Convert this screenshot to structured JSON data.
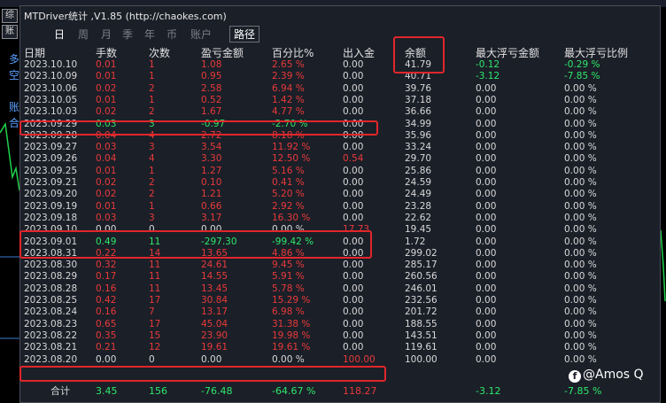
{
  "window": {
    "title": "MTDriver统计 ,V1.85 (http://chaokes.com)"
  },
  "left_tabs": [
    "综",
    "账"
  ],
  "left_glyphs": [
    "多",
    "空",
    "账",
    "合"
  ],
  "tabs": [
    {
      "label": "日",
      "active": true
    },
    {
      "label": "周",
      "active": false
    },
    {
      "label": "月",
      "active": false
    },
    {
      "label": "季",
      "active": false
    },
    {
      "label": "年",
      "active": false
    },
    {
      "label": "币",
      "active": false
    },
    {
      "label": "账户",
      "active": false
    },
    {
      "label": "路径",
      "active": false,
      "boxed": true
    }
  ],
  "columns": [
    "日期",
    "手数",
    "次数",
    "盈亏金额",
    "百分比%",
    "出入金",
    "余额",
    "最大浮亏金额",
    "最大浮亏比例"
  ],
  "rows": [
    {
      "date": "2023.10.10",
      "lots": "0.01",
      "count": "1",
      "pnl": "1.08",
      "pct": "2.65 %",
      "io": "0.00",
      "bal": "41.79",
      "mfe": "-0.12",
      "mfer": "-0.29 %",
      "tone": "red",
      "mfe_tone": "green"
    },
    {
      "date": "2023.10.09",
      "lots": "0.01",
      "count": "1",
      "pnl": "0.95",
      "pct": "2.39 %",
      "io": "0.00",
      "bal": "40.71",
      "mfe": "-3.12",
      "mfer": "-7.85 %",
      "tone": "red",
      "mfe_tone": "green"
    },
    {
      "date": "2023.10.06",
      "lots": "0.02",
      "count": "2",
      "pnl": "2.58",
      "pct": "6.94 %",
      "io": "0.00",
      "bal": "39.76",
      "mfe": "0.00",
      "mfer": "0.00 %",
      "tone": "red",
      "mfe_tone": "white"
    },
    {
      "date": "2023.10.05",
      "lots": "0.01",
      "count": "1",
      "pnl": "0.52",
      "pct": "1.42 %",
      "io": "0.00",
      "bal": "37.18",
      "mfe": "0.00",
      "mfer": "0.00 %",
      "tone": "red",
      "mfe_tone": "white"
    },
    {
      "date": "2023.10.03",
      "lots": "0.02",
      "count": "2",
      "pnl": "1.67",
      "pct": "4.77 %",
      "io": "0.00",
      "bal": "36.66",
      "mfe": "0.00",
      "mfer": "0.00 %",
      "tone": "red",
      "mfe_tone": "white"
    },
    {
      "date": "2023.09.29",
      "lots": "0.03",
      "count": "3",
      "pnl": "-0.97",
      "pct": "-2.70 %",
      "io": "0.00",
      "bal": "34.99",
      "mfe": "0.00",
      "mfer": "0.00 %",
      "tone": "green",
      "mfe_tone": "white"
    },
    {
      "date": "2023.09.28",
      "lots": "0.04",
      "count": "4",
      "pnl": "2.72",
      "pct": "8.18 %",
      "io": "0.00",
      "bal": "35.96",
      "mfe": "0.00",
      "mfer": "0.00 %",
      "tone": "red",
      "mfe_tone": "white"
    },
    {
      "date": "2023.09.27",
      "lots": "0.03",
      "count": "3",
      "pnl": "3.54",
      "pct": "11.92 %",
      "io": "0.00",
      "bal": "33.24",
      "mfe": "0.00",
      "mfer": "0.00 %",
      "tone": "red",
      "mfe_tone": "white"
    },
    {
      "date": "2023.09.26",
      "lots": "0.04",
      "count": "4",
      "pnl": "3.30",
      "pct": "12.50 %",
      "io": "0.54",
      "bal": "29.70",
      "mfe": "0.00",
      "mfer": "0.00 %",
      "tone": "red",
      "mfe_tone": "white",
      "io_tone": "red"
    },
    {
      "date": "2023.09.25",
      "lots": "0.01",
      "count": "1",
      "pnl": "1.27",
      "pct": "5.16 %",
      "io": "0.00",
      "bal": "25.86",
      "mfe": "0.00",
      "mfer": "0.00 %",
      "tone": "red",
      "mfe_tone": "white"
    },
    {
      "date": "2023.09.21",
      "lots": "0.02",
      "count": "2",
      "pnl": "0.10",
      "pct": "0.41 %",
      "io": "0.00",
      "bal": "24.59",
      "mfe": "0.00",
      "mfer": "0.00 %",
      "tone": "red",
      "mfe_tone": "white"
    },
    {
      "date": "2023.09.20",
      "lots": "0.02",
      "count": "2",
      "pnl": "1.21",
      "pct": "5.20 %",
      "io": "0.00",
      "bal": "24.49",
      "mfe": "0.00",
      "mfer": "0.00 %",
      "tone": "red",
      "mfe_tone": "white"
    },
    {
      "date": "2023.09.19",
      "lots": "0.01",
      "count": "1",
      "pnl": "0.66",
      "pct": "2.92 %",
      "io": "0.00",
      "bal": "23.28",
      "mfe": "0.00",
      "mfer": "0.00 %",
      "tone": "red",
      "mfe_tone": "white"
    },
    {
      "date": "2023.09.18",
      "lots": "0.03",
      "count": "3",
      "pnl": "3.17",
      "pct": "16.30 %",
      "io": "0.00",
      "bal": "22.62",
      "mfe": "0.00",
      "mfer": "0.00 %",
      "tone": "red",
      "mfe_tone": "white"
    },
    {
      "date": "2023.09.10",
      "lots": "0.00",
      "count": "0",
      "pnl": "0.00",
      "pct": "0.00 %",
      "io": "17.73",
      "bal": "19.45",
      "mfe": "0.00",
      "mfer": "0.00 %",
      "tone": "white",
      "mfe_tone": "white",
      "io_tone": "red"
    },
    {
      "date": "2023.09.01",
      "lots": "0.49",
      "count": "11",
      "pnl": "-297.30",
      "pct": "-99.42 %",
      "io": "0.00",
      "bal": "1.72",
      "mfe": "0.00",
      "mfer": "0.00 %",
      "tone": "green",
      "mfe_tone": "white"
    },
    {
      "date": "2023.08.31",
      "lots": "0.22",
      "count": "14",
      "pnl": "13.65",
      "pct": "4.86 %",
      "io": "0.00",
      "bal": "299.02",
      "mfe": "0.00",
      "mfer": "0.00 %",
      "tone": "red",
      "mfe_tone": "white"
    },
    {
      "date": "2023.08.30",
      "lots": "0.32",
      "count": "11",
      "pnl": "24.61",
      "pct": "9.45 %",
      "io": "0.00",
      "bal": "285.17",
      "mfe": "0.00",
      "mfer": "0.00 %",
      "tone": "red",
      "mfe_tone": "white"
    },
    {
      "date": "2023.08.29",
      "lots": "0.17",
      "count": "11",
      "pnl": "14.55",
      "pct": "5.91 %",
      "io": "0.00",
      "bal": "260.56",
      "mfe": "0.00",
      "mfer": "0.00 %",
      "tone": "red",
      "mfe_tone": "white"
    },
    {
      "date": "2023.08.28",
      "lots": "0.16",
      "count": "11",
      "pnl": "13.45",
      "pct": "5.78 %",
      "io": "0.00",
      "bal": "246.01",
      "mfe": "0.00",
      "mfer": "0.00 %",
      "tone": "red",
      "mfe_tone": "white"
    },
    {
      "date": "2023.08.25",
      "lots": "0.42",
      "count": "17",
      "pnl": "30.84",
      "pct": "15.29 %",
      "io": "0.00",
      "bal": "232.56",
      "mfe": "0.00",
      "mfer": "0.00 %",
      "tone": "red",
      "mfe_tone": "white"
    },
    {
      "date": "2023.08.24",
      "lots": "0.16",
      "count": "7",
      "pnl": "13.17",
      "pct": "6.98 %",
      "io": "0.00",
      "bal": "201.72",
      "mfe": "0.00",
      "mfer": "0.00 %",
      "tone": "red",
      "mfe_tone": "white"
    },
    {
      "date": "2023.08.23",
      "lots": "0.65",
      "count": "17",
      "pnl": "45.04",
      "pct": "31.38 %",
      "io": "0.00",
      "bal": "188.55",
      "mfe": "0.00",
      "mfer": "0.00 %",
      "tone": "red",
      "mfe_tone": "white"
    },
    {
      "date": "2023.08.22",
      "lots": "0.35",
      "count": "15",
      "pnl": "23.90",
      "pct": "19.98 %",
      "io": "0.00",
      "bal": "143.51",
      "mfe": "0.00",
      "mfer": "0.00 %",
      "tone": "red",
      "mfe_tone": "white"
    },
    {
      "date": "2023.08.21",
      "lots": "0.21",
      "count": "12",
      "pnl": "19.61",
      "pct": "19.61 %",
      "io": "0.00",
      "bal": "119.61",
      "mfe": "0.00",
      "mfer": "0.00 %",
      "tone": "red",
      "mfe_tone": "white"
    },
    {
      "date": "2023.08.20",
      "lots": "0.00",
      "count": "0",
      "pnl": "0.00",
      "pct": "0.00 %",
      "io": "100.00",
      "bal": "100.00",
      "mfe": "0.00",
      "mfer": "0.00 %",
      "tone": "white",
      "mfe_tone": "white",
      "io_tone": "red"
    }
  ],
  "total": {
    "label": "合计",
    "lots": "3.45",
    "count": "156",
    "pnl": "-76.48",
    "pct": "-64.67 %",
    "io": "118.27",
    "mfe": "-3.12",
    "mfer": "-7.85 %"
  },
  "watermark": {
    "icon": "facebook-icon",
    "text": "@Amos Q"
  },
  "colors": {
    "loss": "#2ee86a",
    "profit": "#e83a3a",
    "highlight": "#e2262b",
    "panel": "#1b1f28"
  }
}
